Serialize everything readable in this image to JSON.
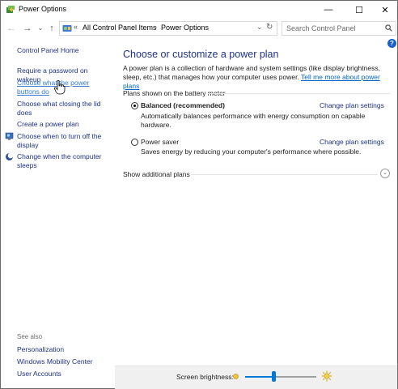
{
  "window": {
    "title": "Power Options",
    "controls": {
      "minimize": "—",
      "maximize": "☐",
      "close": "✕"
    }
  },
  "nav": {
    "back": "←",
    "forward": "→",
    "recent": "⌄",
    "up": "↑",
    "refresh": "↻",
    "dropdown": "⌄",
    "prefix": "«",
    "breadcrumb": [
      "All Control Panel Items",
      "Power Options"
    ],
    "separator": "›",
    "search_placeholder": "Search Control Panel"
  },
  "help": "?",
  "left_pane": {
    "home": "Control Panel Home",
    "links": [
      "Require a password on wakeup",
      "Choose what the power buttons do",
      "Choose what closing the lid does",
      "Create a power plan",
      "Choose when to turn off the display",
      "Change when the computer sleeps"
    ],
    "see_also_label": "See also",
    "see_also": [
      "Personalization",
      "Windows Mobility Center",
      "User Accounts"
    ]
  },
  "main": {
    "heading": "Choose or customize a power plan",
    "description": "A power plan is a collection of hardware and system settings (like display brightness, sleep, etc.) that manages how your computer uses power.",
    "learn_more": "Tell me more about power plans",
    "section_label": "Plans shown on the battery meter",
    "plans": [
      {
        "name": "Balanced (recommended)",
        "selected": true,
        "description": "Automatically balances performance with energy consumption on capable hardware.",
        "change_link": "Change plan settings"
      },
      {
        "name": "Power saver",
        "selected": false,
        "description": "Saves energy by reducing your computer's performance where possible.",
        "change_link": "Change plan settings"
      }
    ],
    "show_additional": "Show additional plans",
    "expand_glyph": "⌄"
  },
  "bottom": {
    "brightness_label": "Screen brightness:",
    "brightness_level": 0.4
  },
  "colors": {
    "link": "#1e3287",
    "accent": "#0078d7",
    "hyperlink": "#0066cc"
  }
}
